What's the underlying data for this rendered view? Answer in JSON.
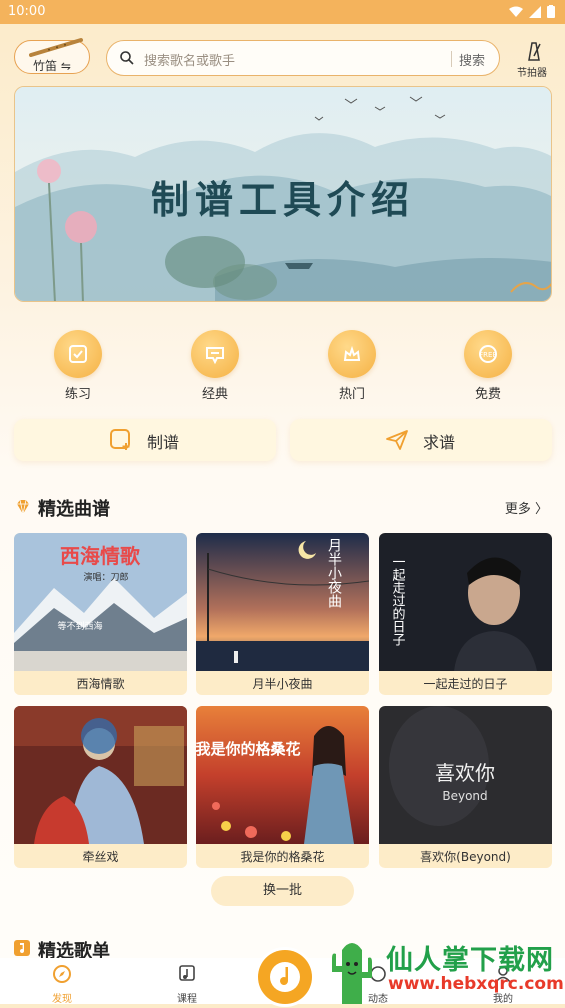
{
  "status_bar": {
    "time": "10:00"
  },
  "header": {
    "instrument_label": "竹笛 ⇋",
    "search_placeholder": "搜索歌名或歌手",
    "search_button": "搜索",
    "metronome_label": "节拍器"
  },
  "banner": {
    "title": "制谱工具介绍"
  },
  "categories": [
    {
      "label": "练习",
      "icon": "practice-icon"
    },
    {
      "label": "经典",
      "icon": "classic-icon"
    },
    {
      "label": "热门",
      "icon": "hot-icon"
    },
    {
      "label": "免费",
      "icon": "free-icon"
    }
  ],
  "actions": [
    {
      "label": "制谱",
      "icon": "compose-icon"
    },
    {
      "label": "求谱",
      "icon": "request-icon"
    }
  ],
  "featured_scores": {
    "title": "精选曲谱",
    "more": "更多 〉",
    "items": [
      {
        "title": "西海情歌",
        "cover_text": "西海情歌",
        "cover_sub": "演唱：刀郎",
        "cover_line": "等不到西海"
      },
      {
        "title": "月半小夜曲",
        "cover_text": "月半小夜曲"
      },
      {
        "title": "一起走过的日子",
        "cover_text": "一起走过的日子"
      },
      {
        "title": "牵丝戏",
        "cover_text": ""
      },
      {
        "title": "我是你的格桑花",
        "cover_text": "我是你的格桑花"
      },
      {
        "title": "喜欢你(Beyond)",
        "cover_text": "喜欢你",
        "cover_sub": "Beyond"
      }
    ],
    "refresh": "换一批"
  },
  "featured_playlists": {
    "title": "精选歌单"
  },
  "tab_bar": {
    "tabs": [
      {
        "label": "发现",
        "icon": "discover-icon",
        "active": true
      },
      {
        "label": "课程",
        "icon": "course-icon",
        "active": false
      },
      {
        "label": "动态",
        "icon": "feed-icon",
        "active": false
      },
      {
        "label": "我的",
        "icon": "profile-icon",
        "active": false
      }
    ]
  },
  "watermark": {
    "text": "仙人掌下载网",
    "url": "www.hebxqrc.com"
  },
  "colors": {
    "accent": "#f5a623",
    "header_bg": "#f4b35c",
    "card_bg": "#fdecc8"
  }
}
